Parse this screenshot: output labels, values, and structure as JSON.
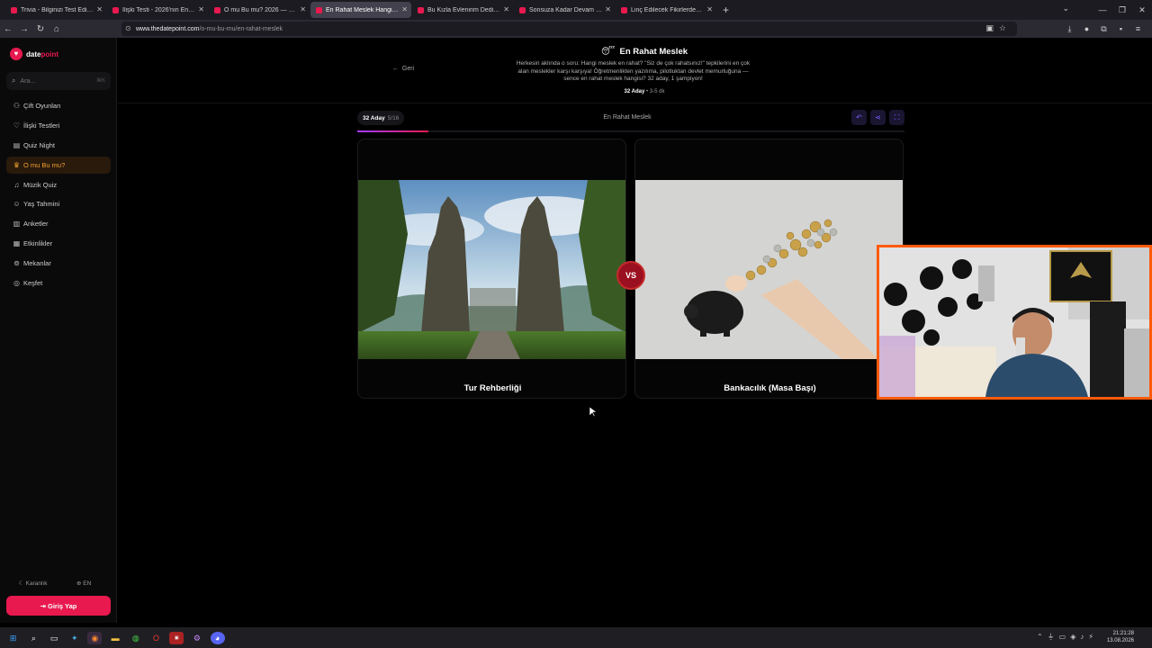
{
  "browser": {
    "tabs": [
      {
        "title": "Trivia - Bilginizi Test Edin - Quiz",
        "active": false
      },
      {
        "title": "İlişki Testi - 2026'nın En Viral Te",
        "active": false
      },
      {
        "title": "O mu Bu mu? 2026 — Sevgilini",
        "active": false
      },
      {
        "title": "En Rahat Meslek Hangisi? — Se",
        "active": true
      },
      {
        "title": "Bu Kızla Evlenirim Dedirtecek Ö",
        "active": false
      },
      {
        "title": "Sonsuza Kadar Devam Edecek İ",
        "active": false
      },
      {
        "title": "Linç Edilecek Fikirlerden Hangisi",
        "active": false
      }
    ],
    "url_host": "www.thedatepoint.com",
    "url_path": "/o-mu-bu-mu/en-rahat-meslek"
  },
  "sidebar": {
    "brand_a": "date",
    "brand_b": "point",
    "search_placeholder": "Ara...",
    "search_kbd": "⌘K",
    "items": [
      {
        "label": "Çift Oyunları",
        "icon": "gamepad-icon",
        "active": false
      },
      {
        "label": "İlişki Testleri",
        "icon": "heart-icon",
        "active": false
      },
      {
        "label": "Quiz Night",
        "icon": "book-icon",
        "active": false
      },
      {
        "label": "O mu Bu mu?",
        "icon": "trophy-icon",
        "active": true
      },
      {
        "label": "Müzik Quiz",
        "icon": "headphones-icon",
        "active": false
      },
      {
        "label": "Yaş Tahmini",
        "icon": "user-icon",
        "active": false
      },
      {
        "label": "Anketler",
        "icon": "chart-icon",
        "active": false
      },
      {
        "label": "Etkinlikler",
        "icon": "calendar-icon",
        "active": false
      },
      {
        "label": "Mekanlar",
        "icon": "pin-icon",
        "active": false
      },
      {
        "label": "Keşfet",
        "icon": "compass-icon",
        "active": false
      }
    ],
    "dark_label": "Karanlık",
    "lang_label": "EN",
    "login_label": "Giriş Yap"
  },
  "header": {
    "back_label": "Geri",
    "title": "En Rahat Meslek",
    "title_emoji": "😴",
    "description": "Herkesin aklında o soru: Hangi meslek en rahat? \"Siz de çok rahatsınız!\" tepkilerini en çok alan meslekler karşı karşıya! Öğretmenlikten yazılıma, pilotluktan devlet memurluğuna — sence en rahat meslek hangisi? 32 aday, 1 şampiyon!",
    "meta_count": "32 Aday",
    "meta_time": "3-5 dk"
  },
  "game": {
    "round_label": "32 Aday",
    "round_progress": "5/16",
    "progress_fraction": 0.1295,
    "center_title": "En Rahat Meslek",
    "vs_label": "VS",
    "left": {
      "label": "Tur Rehberliği"
    },
    "right": {
      "label": "Bankacılık (Masa Başı)"
    }
  },
  "taskbar": {
    "time": "21:21:28",
    "date": "13.08.2026"
  }
}
